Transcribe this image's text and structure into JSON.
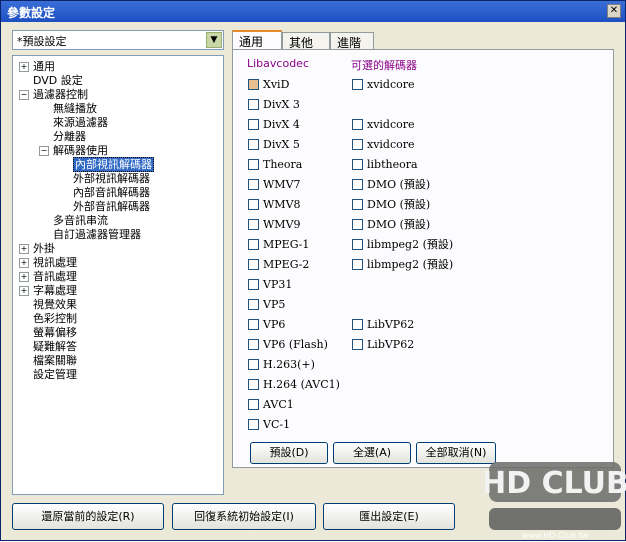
{
  "window": {
    "title": "參數設定",
    "close_glyph": "✕"
  },
  "preset": {
    "value": "*預設設定",
    "arrow_glyph": "▼"
  },
  "tree": [
    {
      "label": "通用",
      "level": 0,
      "toggle": "+"
    },
    {
      "label": "DVD 設定",
      "level": 0,
      "toggle": ""
    },
    {
      "label": "過濾器控制",
      "level": 0,
      "toggle": "−"
    },
    {
      "label": "無縫播放",
      "level": 1,
      "toggle": ""
    },
    {
      "label": "來源過濾器",
      "level": 1,
      "toggle": ""
    },
    {
      "label": "分離器",
      "level": 1,
      "toggle": ""
    },
    {
      "label": "解碼器使用",
      "level": 1,
      "toggle": "−"
    },
    {
      "label": "內部視訊解碼器",
      "level": 2,
      "toggle": "",
      "selected": true
    },
    {
      "label": "外部視訊解碼器",
      "level": 2,
      "toggle": ""
    },
    {
      "label": "內部音訊解碼器",
      "level": 2,
      "toggle": ""
    },
    {
      "label": "外部音訊解碼器",
      "level": 2,
      "toggle": ""
    },
    {
      "label": "多音訊串流",
      "level": 1,
      "toggle": ""
    },
    {
      "label": "自訂過濾器管理器",
      "level": 1,
      "toggle": ""
    },
    {
      "label": "外掛",
      "level": 0,
      "toggle": "+"
    },
    {
      "label": "視訊處理",
      "level": 0,
      "toggle": "+"
    },
    {
      "label": "音訊處理",
      "level": 0,
      "toggle": "+"
    },
    {
      "label": "字幕處理",
      "level": 0,
      "toggle": "+"
    },
    {
      "label": "視覺效果",
      "level": 0,
      "toggle": ""
    },
    {
      "label": "色彩控制",
      "level": 0,
      "toggle": ""
    },
    {
      "label": "螢幕偏移",
      "level": 0,
      "toggle": ""
    },
    {
      "label": "疑難解答",
      "level": 0,
      "toggle": ""
    },
    {
      "label": "檔案關聯",
      "level": 0,
      "toggle": ""
    },
    {
      "label": "設定管理",
      "level": 0,
      "toggle": ""
    }
  ],
  "tabs": [
    {
      "label": "通用",
      "active": true
    },
    {
      "label": "其他",
      "active": false
    },
    {
      "label": "進階",
      "active": false
    }
  ],
  "columns": {
    "left": "Libavcodec",
    "right": "可選的解碼器"
  },
  "rows": [
    {
      "left": "XviD",
      "left_checked": true,
      "right": "xvidcore"
    },
    {
      "left": "DivX 3",
      "right": ""
    },
    {
      "left": "DivX 4",
      "right": "xvidcore"
    },
    {
      "left": "DivX 5",
      "right": "xvidcore"
    },
    {
      "left": "Theora",
      "right": "libtheora"
    },
    {
      "left": "WMV7",
      "right": "DMO (預設)"
    },
    {
      "left": "WMV8",
      "right": "DMO (預設)"
    },
    {
      "left": "WMV9",
      "right": "DMO (預設)"
    },
    {
      "left": "MPEG-1",
      "right": "libmpeg2 (預設)"
    },
    {
      "left": "MPEG-2",
      "right": "libmpeg2 (預設)"
    },
    {
      "left": "VP31",
      "right": ""
    },
    {
      "left": "VP5",
      "right": ""
    },
    {
      "left": "VP6",
      "right": "LibVP62"
    },
    {
      "left": "VP6 (Flash)",
      "right": "LibVP62"
    },
    {
      "left": "H.263(+)",
      "right": ""
    },
    {
      "left": "H.264 (AVC1)",
      "right": ""
    },
    {
      "left": "AVC1",
      "right": ""
    },
    {
      "left": "VC-1",
      "right": ""
    }
  ],
  "panel_buttons": {
    "default": "預設(D)",
    "select_all": "全選(A)",
    "deselect_all": "全部取消(N)"
  },
  "bottom_buttons": {
    "restore": "還原當前的設定(R)",
    "reset": "回復系統初始設定(I)",
    "export": "匯出設定(E)"
  },
  "logo": {
    "text": "HD CLUB",
    "url_text": "www.HD-Club.tw"
  }
}
